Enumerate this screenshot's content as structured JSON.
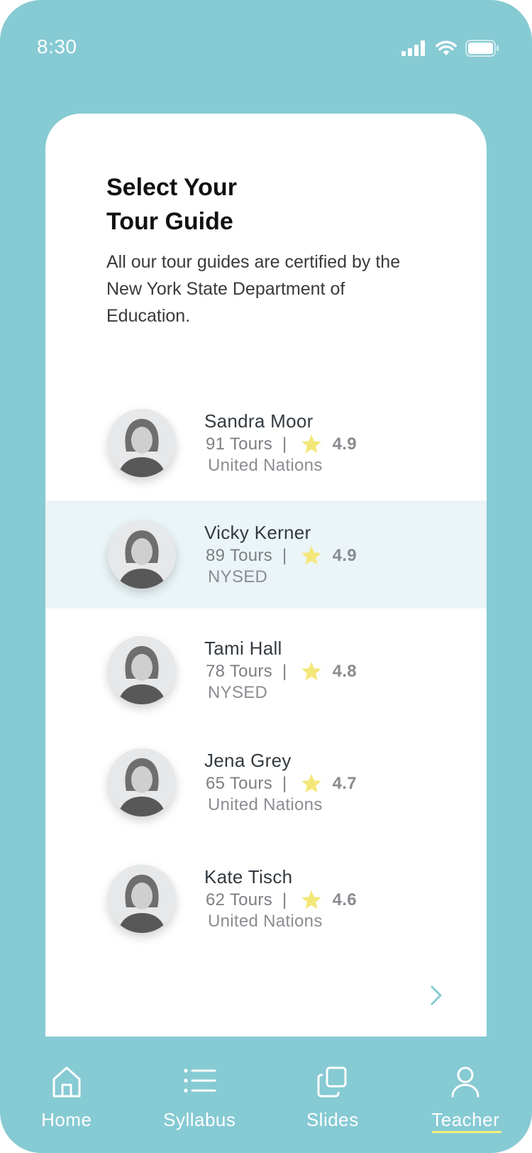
{
  "status": {
    "time": "8:30"
  },
  "card": {
    "title_line1": "Select Your",
    "title_line2": "Tour Guide",
    "subtitle": "All our tour guides are certified by the New York State Department of Education."
  },
  "guides": [
    {
      "name": "Sandra Moor",
      "tours": "91 Tours",
      "rating": "4.9",
      "org": "United Nations",
      "selected": false
    },
    {
      "name": "Vicky Kerner",
      "tours": "89 Tours",
      "rating": "4.9",
      "org": "NYSED",
      "selected": true
    },
    {
      "name": "Tami Hall",
      "tours": "78 Tours",
      "rating": "4.8",
      "org": "NYSED",
      "selected": false
    },
    {
      "name": "Jena Grey",
      "tours": "65 Tours",
      "rating": "4.7",
      "org": "United Nations",
      "selected": false
    },
    {
      "name": "Kate Tisch",
      "tours": "62 Tours",
      "rating": "4.6",
      "org": "United Nations",
      "selected": false
    }
  ],
  "separator": "|",
  "nav": {
    "items": [
      {
        "label": "Home",
        "icon": "home-icon"
      },
      {
        "label": "Syllabus",
        "icon": "list-icon"
      },
      {
        "label": "Slides",
        "icon": "slides-icon"
      },
      {
        "label": "Teacher",
        "icon": "user-icon",
        "active": true
      }
    ]
  },
  "colors": {
    "background": "#86cad3",
    "selected_row": "#ebf5f7",
    "star": "#f4e77a",
    "active_underline": "#f3ee7a",
    "chevron": "#86cad3"
  }
}
